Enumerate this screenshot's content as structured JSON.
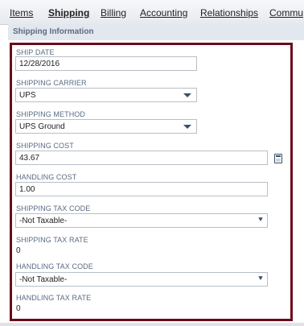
{
  "tabs": [
    {
      "label": "Items",
      "active": false
    },
    {
      "label": "Shipping",
      "active": true
    },
    {
      "label": "Billing",
      "active": false
    },
    {
      "label": "Accounting",
      "active": false
    },
    {
      "label": "Relationships",
      "active": false
    },
    {
      "label": "Commu",
      "active": false
    }
  ],
  "section": {
    "title": "Shipping Information"
  },
  "fields": {
    "ship_date": {
      "label": "SHIP DATE",
      "value": "12/28/2016"
    },
    "shipping_carrier": {
      "label": "SHIPPING CARRIER",
      "value": "UPS"
    },
    "shipping_method": {
      "label": "SHIPPING METHOD",
      "value": "UPS Ground"
    },
    "shipping_cost": {
      "label": "SHIPPING COST",
      "value": "43.67"
    },
    "handling_cost": {
      "label": "HANDLING COST",
      "value": "1.00"
    },
    "shipping_tax_code": {
      "label": "SHIPPING TAX CODE",
      "value": "-Not Taxable-"
    },
    "shipping_tax_rate": {
      "label": "SHIPPING TAX RATE",
      "value": "0"
    },
    "handling_tax_code": {
      "label": "HANDLING TAX CODE",
      "value": "-Not Taxable-"
    },
    "handling_tax_rate": {
      "label": "HANDLING TAX RATE",
      "value": "0"
    }
  },
  "icons": {
    "calculator": "calculator-icon",
    "dropdown": "caret-down-icon",
    "multiselect": "double-chevron-down-icon"
  },
  "colors": {
    "panel_border": "#6b0a1a",
    "label": "#5a6b84",
    "section_bg": "#e3e8ee"
  }
}
